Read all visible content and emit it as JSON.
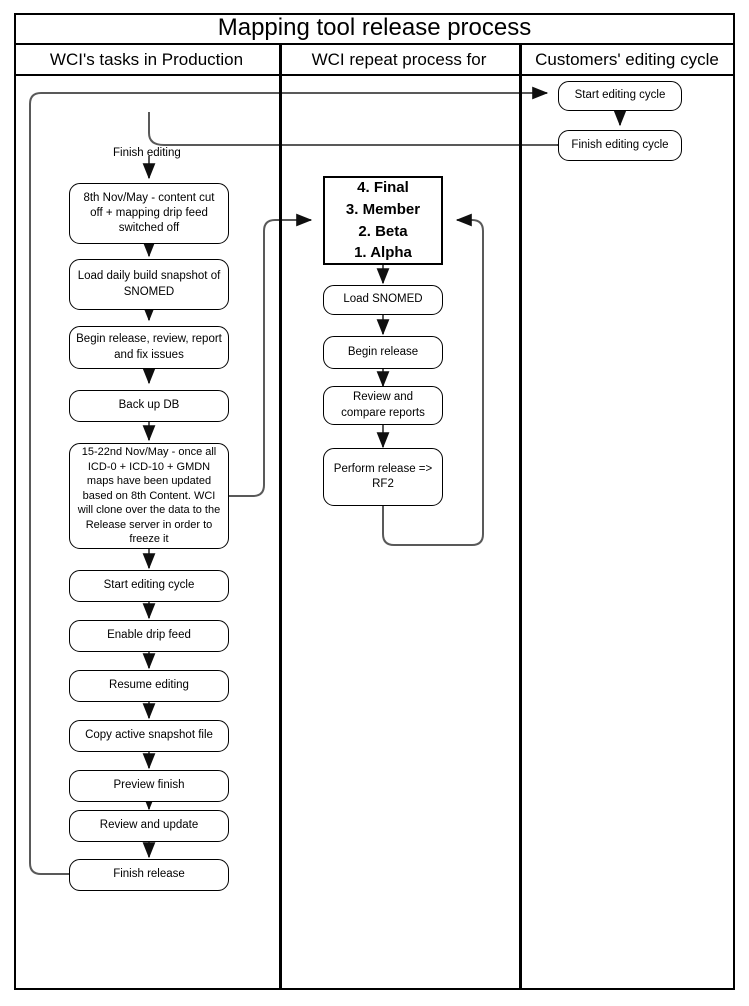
{
  "diagram": {
    "title": "Mapping tool release process",
    "lanes": [
      {
        "id": "lane-production",
        "label": "WCI's tasks in Production"
      },
      {
        "id": "lane-repeat",
        "label": "WCI repeat process for"
      },
      {
        "id": "lane-customers",
        "label": "Customers' editing cycle"
      }
    ],
    "edge_labels": {
      "finish_editing": "Finish editing"
    },
    "nodes": {
      "production": [
        {
          "id": "content-cut-off",
          "label": "8th Nov/May - content cut off + mapping drip feed switched off"
        },
        {
          "id": "load-daily-build",
          "label": "Load daily build snapshot of SNOMED"
        },
        {
          "id": "begin-release-review",
          "label": "Begin release, review, report and fix issues"
        },
        {
          "id": "back-up-db",
          "label": "Back up DB"
        },
        {
          "id": "maps-updated-clone",
          "label": "15-22nd Nov/May - once all ICD-0 + ICD-10 + GMDN maps have been updated based on 8th Content. WCI will clone over the data to the Release server in order to freeze it"
        },
        {
          "id": "start-editing-cycle-prod",
          "label": "Start editing cycle"
        },
        {
          "id": "enable-drip-feed",
          "label": "Enable drip feed"
        },
        {
          "id": "resume-editing",
          "label": "Resume editing"
        },
        {
          "id": "copy-active-snapshot",
          "label": "Copy active snapshot file"
        },
        {
          "id": "preview-finish",
          "label": "Preview finish"
        },
        {
          "id": "review-and-update",
          "label": "Review and update"
        },
        {
          "id": "finish-release",
          "label": "Finish release"
        }
      ],
      "repeat": [
        {
          "id": "release-stages",
          "label": "4. Final\n3. Member\n2. Beta\n1. Alpha"
        },
        {
          "id": "load-snomed",
          "label": "Load SNOMED"
        },
        {
          "id": "begin-release",
          "label": "Begin release"
        },
        {
          "id": "review-compare-reports",
          "label": "Review and compare reports"
        },
        {
          "id": "perform-release-rf2",
          "label": "Perform release => RF2"
        }
      ],
      "customers": [
        {
          "id": "start-editing-cycle",
          "label": "Start editing cycle"
        },
        {
          "id": "finish-editing-cycle",
          "label": "Finish editing cycle"
        }
      ]
    },
    "colors": {
      "border": "#000000",
      "connector": "#595959",
      "background": "#ffffff"
    }
  }
}
